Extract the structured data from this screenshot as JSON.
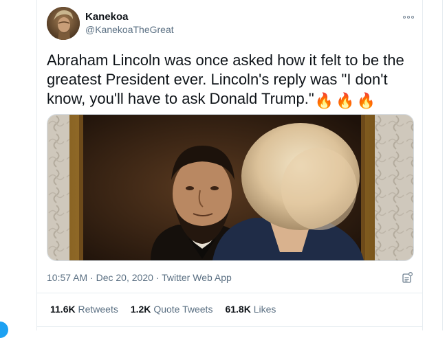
{
  "tweet": {
    "author": {
      "display_name": "Kanekoa",
      "handle": "@KanekoaTheGreat"
    },
    "text": "Abraham Lincoln was once asked how it felt to be the greatest President ever. Lincoln's reply was \"I don't know, you'll have to ask Donald Trump.\"",
    "emoji": [
      "🔥",
      "🔥",
      "🔥"
    ],
    "time": "10:57 AM",
    "separator": "·",
    "date": "Dec 20, 2020",
    "source": "Twitter Web App",
    "stats": {
      "retweets_count": "11.6K",
      "retweets_label": "Retweets",
      "quote_count": "1.2K",
      "quote_label": "Quote Tweets",
      "likes_count": "61.8K",
      "likes_label": "Likes"
    }
  },
  "colors": {
    "accent": "#1da1f2",
    "text_primary": "#0f1419",
    "text_secondary": "#5b7083",
    "border": "#e6ecf0"
  },
  "icons": {
    "more": "more-horizontal-icon",
    "analytics": "analytics-icon",
    "emoji": "fire-emoji-icon"
  }
}
